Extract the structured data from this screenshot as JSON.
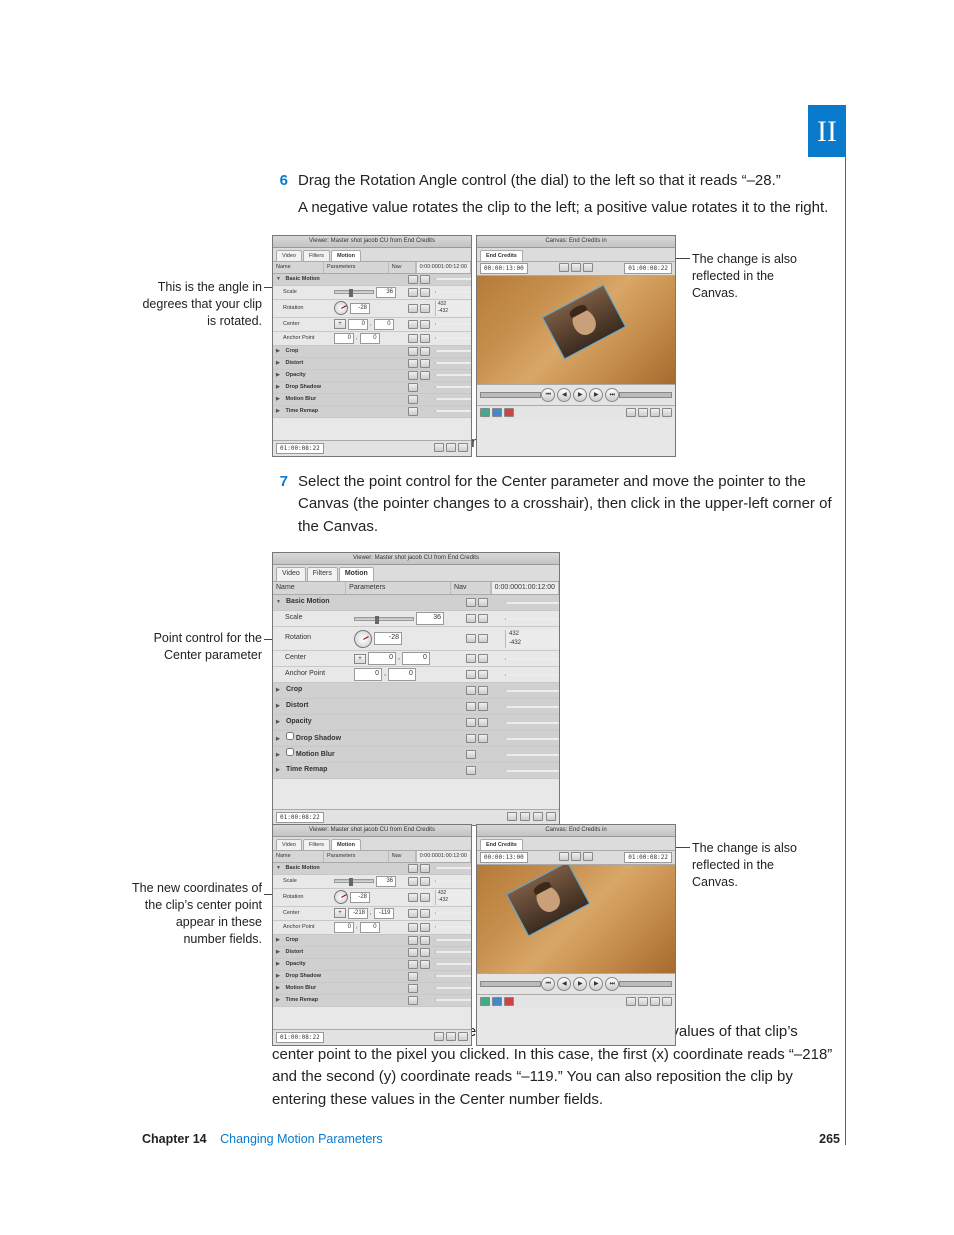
{
  "part_tab": "II",
  "steps": {
    "s6": {
      "num": "6",
      "text": "Drag the Rotation Angle control (the dial) to the left so that it reads “–28.”",
      "sub": "A negative value rotates the clip to the left; a positive value rotates it to the right."
    },
    "s6_after": "Next, you’ll change the position of this clip in the Canvas.",
    "s7": {
      "num": "7",
      "text": "Select the point control for the Center parameter and move the pointer to the Canvas (the pointer changes to a crosshair), then click in the upper-left corner of the Canvas."
    },
    "s7_after": "Clicking in the Canvas with the crosshair moves the x and y values of that clip’s center point to the pixel you clicked. In this case, the first (x) coordinate reads “–218” and the second (y) coordinate reads “–119.” You can also reposition the clip by entering these values in the Center number fields."
  },
  "callouts": {
    "rotation_left": "This is the angle in degrees that your clip is rotated.",
    "canvas_right": "The change is also reflected in the Canvas.",
    "point_left": "Point control for the Center parameter",
    "coords_left": "The new coordinates of the clip’s center point appear in these number fields."
  },
  "viewer": {
    "title": "Viewer: Master shot jacob CU from End Credits",
    "tabs": {
      "video": "Video",
      "filters": "Filters",
      "motion": "Motion"
    },
    "cols": {
      "name": "Name",
      "params": "Parameters",
      "nav": "Nav"
    },
    "tc_head_a": "0:00:00",
    "tc_head_b": "01:00:12:00",
    "rows": {
      "basic": "Basic Motion",
      "scale": "Scale",
      "scale_val": "36",
      "rotation": "Rotation",
      "rotation_val": "-28",
      "rotation_tick_hi": "432",
      "rotation_tick_lo": "-432",
      "center": "Center",
      "center_x": "0",
      "center_y": "0",
      "center_x2": "-218",
      "center_y2": "-119",
      "anchor": "Anchor Point",
      "anchor_x": "0",
      "anchor_y": "0",
      "crop": "Crop",
      "distort": "Distort",
      "opacity": "Opacity",
      "drop": "Drop Shadow",
      "blur": "Motion Blur",
      "remap": "Time Remap"
    },
    "tc_foot": "01:00:08:22"
  },
  "canvas": {
    "title": "Canvas: End Credits in",
    "tab": "End Credits",
    "tc_right": "01:00:08:22",
    "tc_dur": "00:00:13:00"
  },
  "footer": {
    "chapter_label": "Chapter 14",
    "chapter_title": "Changing Motion Parameters",
    "page": "265"
  }
}
